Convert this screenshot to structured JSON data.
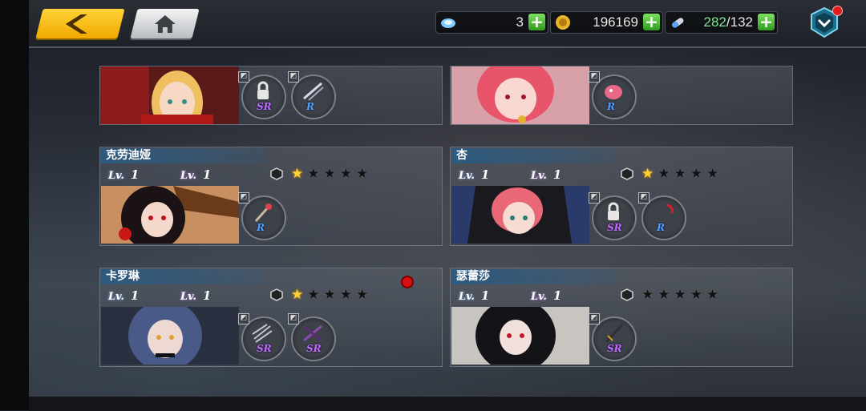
{
  "header": {
    "back_label": "back",
    "home_label": "home",
    "resources": [
      {
        "icon": "diamond-icon",
        "value": "3"
      },
      {
        "icon": "gold-coin-icon",
        "value": "196169"
      },
      {
        "icon": "stamina-capsule-icon",
        "current": "282",
        "separator": "/",
        "max": "132"
      }
    ],
    "menu_icon": "shield-menu-icon"
  },
  "cards": [
    {
      "name": "",
      "show_level": false,
      "portrait": "blonde-knight-portrait",
      "equips": [
        {
          "grade": "SR",
          "locked": true,
          "icon": "lock-icon"
        },
        {
          "grade": "R",
          "icon": "twin-blades-icon"
        }
      ]
    },
    {
      "name": "",
      "show_level": false,
      "portrait": "pink-hair-girl-portrait",
      "equips": [
        {
          "grade": "R",
          "icon": "pink-creature-icon"
        }
      ]
    },
    {
      "name": "克劳迪娅",
      "show_level": true,
      "lv1": "1",
      "lv2": "1",
      "stars": 1,
      "portrait": "witch-portrait",
      "equips": [
        {
          "grade": "R",
          "icon": "staff-icon"
        }
      ]
    },
    {
      "name": "杏",
      "show_level": true,
      "lv1": "1",
      "lv2": "1",
      "stars": 1,
      "portrait": "pink-hood-girl-portrait",
      "equips": [
        {
          "grade": "SR",
          "locked": true,
          "icon": "lock-icon"
        },
        {
          "grade": "R",
          "icon": "scythe-icon"
        }
      ]
    },
    {
      "name": "卡罗琳",
      "show_level": true,
      "lv1": "1",
      "lv2": "1",
      "stars": 1,
      "portrait": "blue-hair-girl-portrait",
      "equips": [
        {
          "grade": "SR",
          "icon": "triple-dagger-icon"
        },
        {
          "grade": "SR",
          "icon": "dark-blades-icon"
        }
      ]
    },
    {
      "name": "瑟蕾莎",
      "show_level": true,
      "lv1": "1",
      "lv2": "1",
      "stars": 0,
      "portrait": "black-hair-girl-portrait",
      "equips": [
        {
          "grade": "SR",
          "icon": "sword-icon"
        }
      ]
    }
  ],
  "colors": {
    "accent_yellow": "#f0a800",
    "star_gold": "#ffd338",
    "grade_R": "#4fa3ff",
    "grade_SR": "#c46cff",
    "name_bar": "#2c5a80"
  }
}
